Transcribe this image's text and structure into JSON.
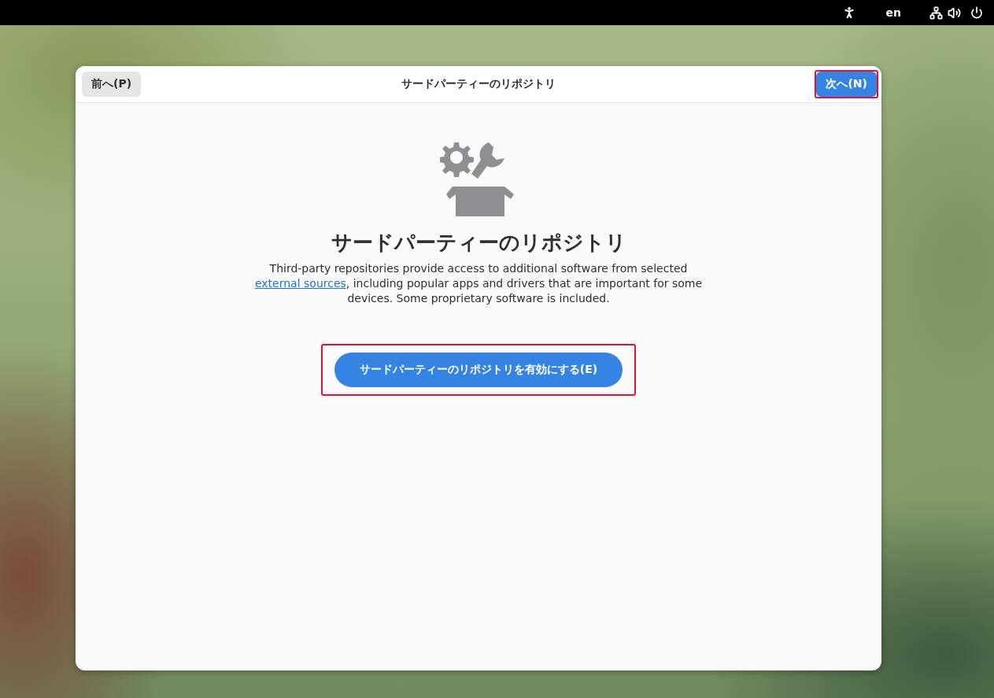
{
  "top_bar": {
    "language": "en"
  },
  "dialog": {
    "title": "サードパーティーのリポジトリ",
    "back_button": {
      "label": "前へ(P)",
      "highlighted": false
    },
    "next_button": {
      "label": "次へ(N)",
      "highlighted": true
    },
    "heading": "サードパーティーのリポジトリ",
    "description": {
      "before": "Third-party repositories provide access to additional software from selected",
      "link": "external sources",
      "after": ", including popular apps and drivers that are important for some devices. Some proprietary software is included."
    },
    "enable_button": {
      "label": "サードパーティーのリポジトリを有効にする(E)",
      "highlighted": true
    }
  }
}
